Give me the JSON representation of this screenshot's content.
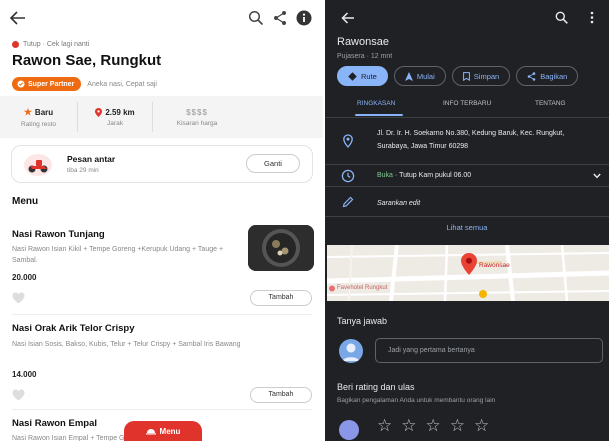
{
  "gofood": {
    "status": "Tutup · Cek lagi nanti",
    "name": "Rawon Sae, Rungkut",
    "badge": "Super Partner",
    "tags": "Aneka nasi, Cepat saji",
    "stats": [
      {
        "value": "Baru",
        "label": "Rating resto"
      },
      {
        "value": "2.59 km",
        "label": "Jarak"
      },
      {
        "value": "$$$$",
        "label": "Kisaran harga"
      }
    ],
    "delivery": {
      "title": "Pesan antar",
      "subtitle": "tiba 29 min",
      "button": "Ganti"
    },
    "menu_title": "Menu",
    "items": [
      {
        "name": "Nasi Rawon Tunjang",
        "desc": "Nasi Rawon Isian Kikil + Tempe Goreng +Kerupuk Udang + Tauge + Sambal.",
        "price": "20.000",
        "button": "Tambah"
      },
      {
        "name": "Nasi Orak Arik Telor Crispy",
        "desc": "Nasi Isian Sosis, Bakso, Kubis, Telur + Telur Crispy + Sambal Iris Bawang",
        "price": "14.000",
        "button": "Tambah"
      },
      {
        "name": "Nasi Rawon Empal",
        "desc": "Nasi Rawon Isian Empal + Tempe Goreng + Kerupuk",
        "price": "",
        "button": ""
      }
    ],
    "fab": "Menu"
  },
  "maps": {
    "name": "Rawonsae",
    "subtitle": "Pujasera · 12 mnt",
    "actions": [
      "Rute",
      "Mulai",
      "Simpan",
      "Bagikan"
    ],
    "tabs": [
      "RINGKASAN",
      "INFO TERBARU",
      "TENTANG"
    ],
    "address": "Jl. Dr. Ir. H. Soekarno No.380, Kedung Baruk, Kec. Rungkut, Surabaya, Jawa Timur 60298",
    "hours_open": "Buka",
    "hours_rest": " · Tutup Kam pukul 06.00",
    "suggest": "Sarankan edit",
    "see_all": "Lihat semua",
    "map_label": "Rawonsae",
    "map_label2": "Favehotel Rungkut",
    "qa_title": "Tanya jawab",
    "qa_placeholder": "Jadi yang pertama bertanya",
    "rate_title": "Beri rating dan ulas",
    "rate_sub": "Bagikan pengalaman Anda untuk membantu orang lain"
  },
  "colors": {
    "gofood_red": "#e0332b",
    "super_partner_orange": "#ee6b12",
    "maps_bg": "#202124",
    "maps_accent": "#8ab4f8",
    "open_green": "#81c995"
  }
}
